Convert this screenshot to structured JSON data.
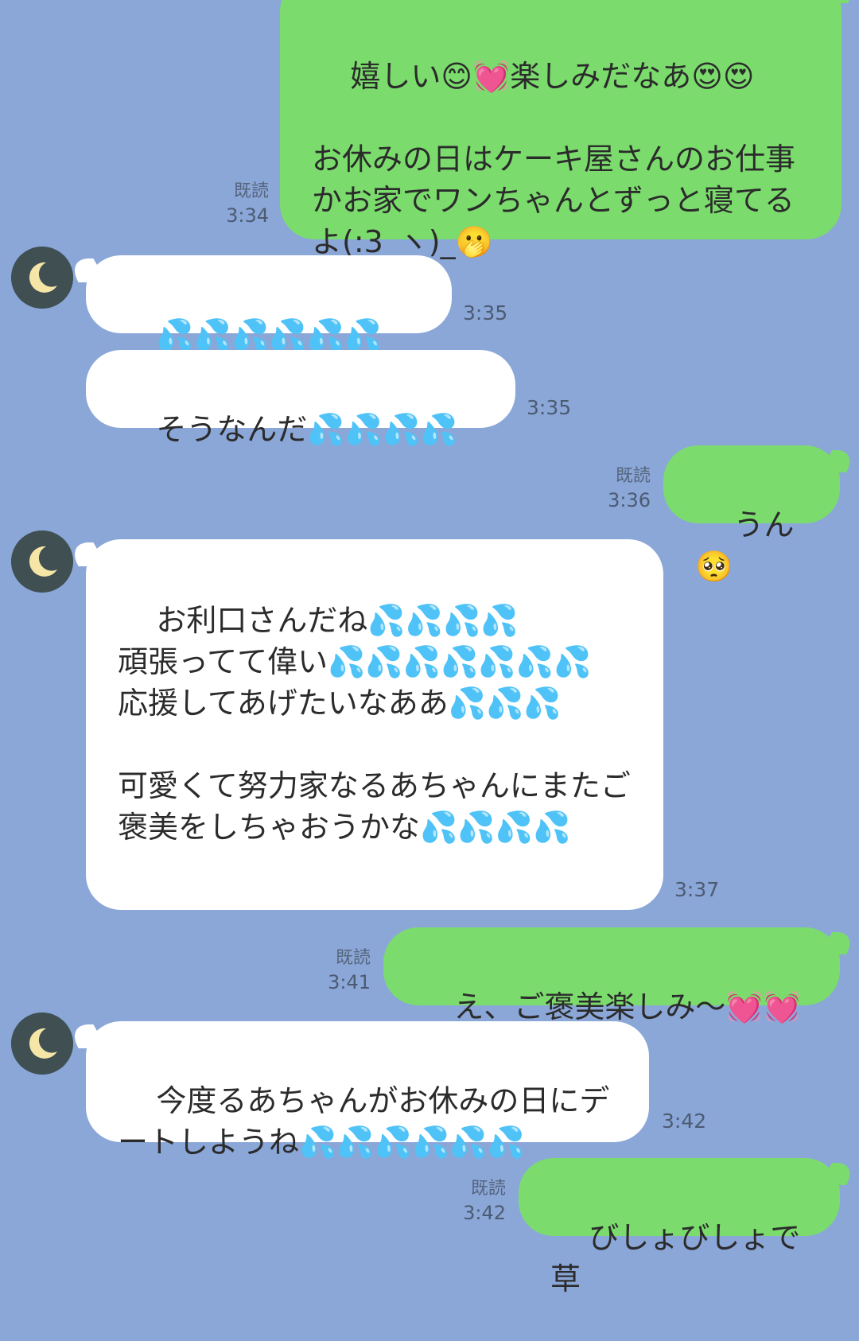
{
  "messages": [
    {
      "side": "sent",
      "text": "嬉しい😊💓楽しみだなあ😍😍\n\nお休みの日はケーキ屋さんのお仕事かお家でワンちゃんとずっと寝てるよ(:3_ヽ)_🫢",
      "read": "既読",
      "time": "3:34"
    },
    {
      "side": "recv",
      "text": "💦💦💦💦💦💦",
      "time": "3:35"
    },
    {
      "side": "recv",
      "text": "そうなんだ💦💦💦💦",
      "time": "3:35"
    },
    {
      "side": "sent",
      "text": "うん🥺",
      "read": "既読",
      "time": "3:36"
    },
    {
      "side": "recv",
      "text": "お利口さんだね💦💦💦💦\n頑張ってて偉い💦💦💦💦💦💦💦\n応援してあげたいなああ💦💦💦\n\n可愛くて努力家なるあちゃんにまたご褒美をしちゃおうかな💦💦💦💦",
      "time": "3:37"
    },
    {
      "side": "sent",
      "text": "え、ご褒美楽しみ〜💓💓",
      "read": "既読",
      "time": "3:41"
    },
    {
      "side": "recv",
      "text": "今度るあちゃんがお休みの日にデートしようね💦💦💦💦💦💦",
      "time": "3:42"
    },
    {
      "side": "sent",
      "text": "びしょびしょで草",
      "read": "既読",
      "time": "3:42"
    }
  ],
  "avatar_icon": "crescent-moon-icon",
  "colors": {
    "background": "#8aa7d8",
    "sent_bubble": "#7bdc6d",
    "received_bubble": "#ffffff"
  }
}
